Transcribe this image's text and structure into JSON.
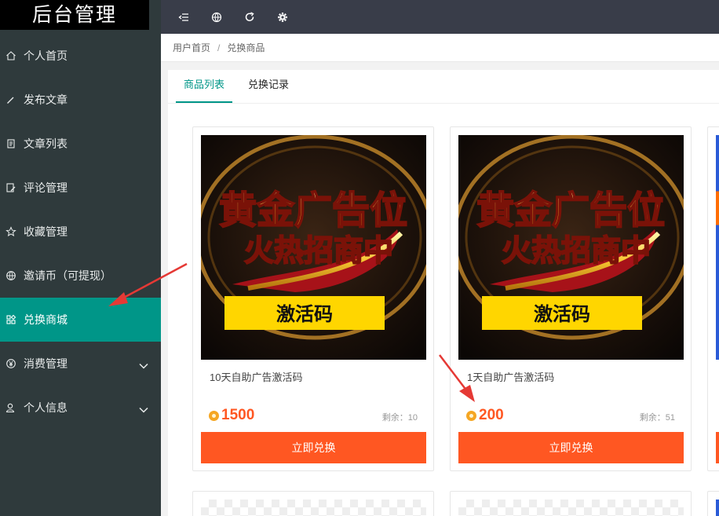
{
  "app": {
    "title": "后台管理"
  },
  "sidebar": {
    "items": [
      {
        "label": "个人首页",
        "icon": "home-icon"
      },
      {
        "label": "发布文章",
        "icon": "pen-icon"
      },
      {
        "label": "文章列表",
        "icon": "list-icon"
      },
      {
        "label": "评论管理",
        "icon": "comment-edit-icon"
      },
      {
        "label": "收藏管理",
        "icon": "star-icon"
      },
      {
        "label": "邀请币（可提现）",
        "icon": "globe-icon"
      },
      {
        "label": "兑换商城",
        "icon": "apps-icon",
        "active": true
      },
      {
        "label": "消费管理",
        "icon": "yen-icon",
        "expandable": true
      },
      {
        "label": "个人信息",
        "icon": "user-icon",
        "expandable": true
      }
    ]
  },
  "topbar": {
    "icons": [
      "collapse-menu-icon",
      "globe-icon",
      "refresh-icon",
      "settings-icon"
    ]
  },
  "breadcrumb": {
    "home": "用户首页",
    "separator": "/",
    "current": "兑换商品"
  },
  "tabs": [
    {
      "label": "商品列表",
      "active": true
    },
    {
      "label": "兑换记录",
      "active": false
    }
  ],
  "products": [
    {
      "name": "10天自助广告激活码",
      "price": "1500",
      "stock_label": "剩余：",
      "stock": "10",
      "button": "立即兑换",
      "image": {
        "line1": "黄金广告位",
        "line2": "火热招商中",
        "badge": "激活码"
      }
    },
    {
      "name": "1天自助广告激活码",
      "price": "200",
      "stock_label": "剩余：",
      "stock": "51",
      "button": "立即兑换",
      "image": {
        "line1": "黄金广告位",
        "line2": "火热招商中",
        "badge": "激活码"
      }
    }
  ],
  "colors": {
    "sidebar_bg": "#2f3a3c",
    "active": "#009688",
    "accent": "#ff5722",
    "topbar_bg": "#393d49",
    "annotation_arrow": "#e53935"
  }
}
